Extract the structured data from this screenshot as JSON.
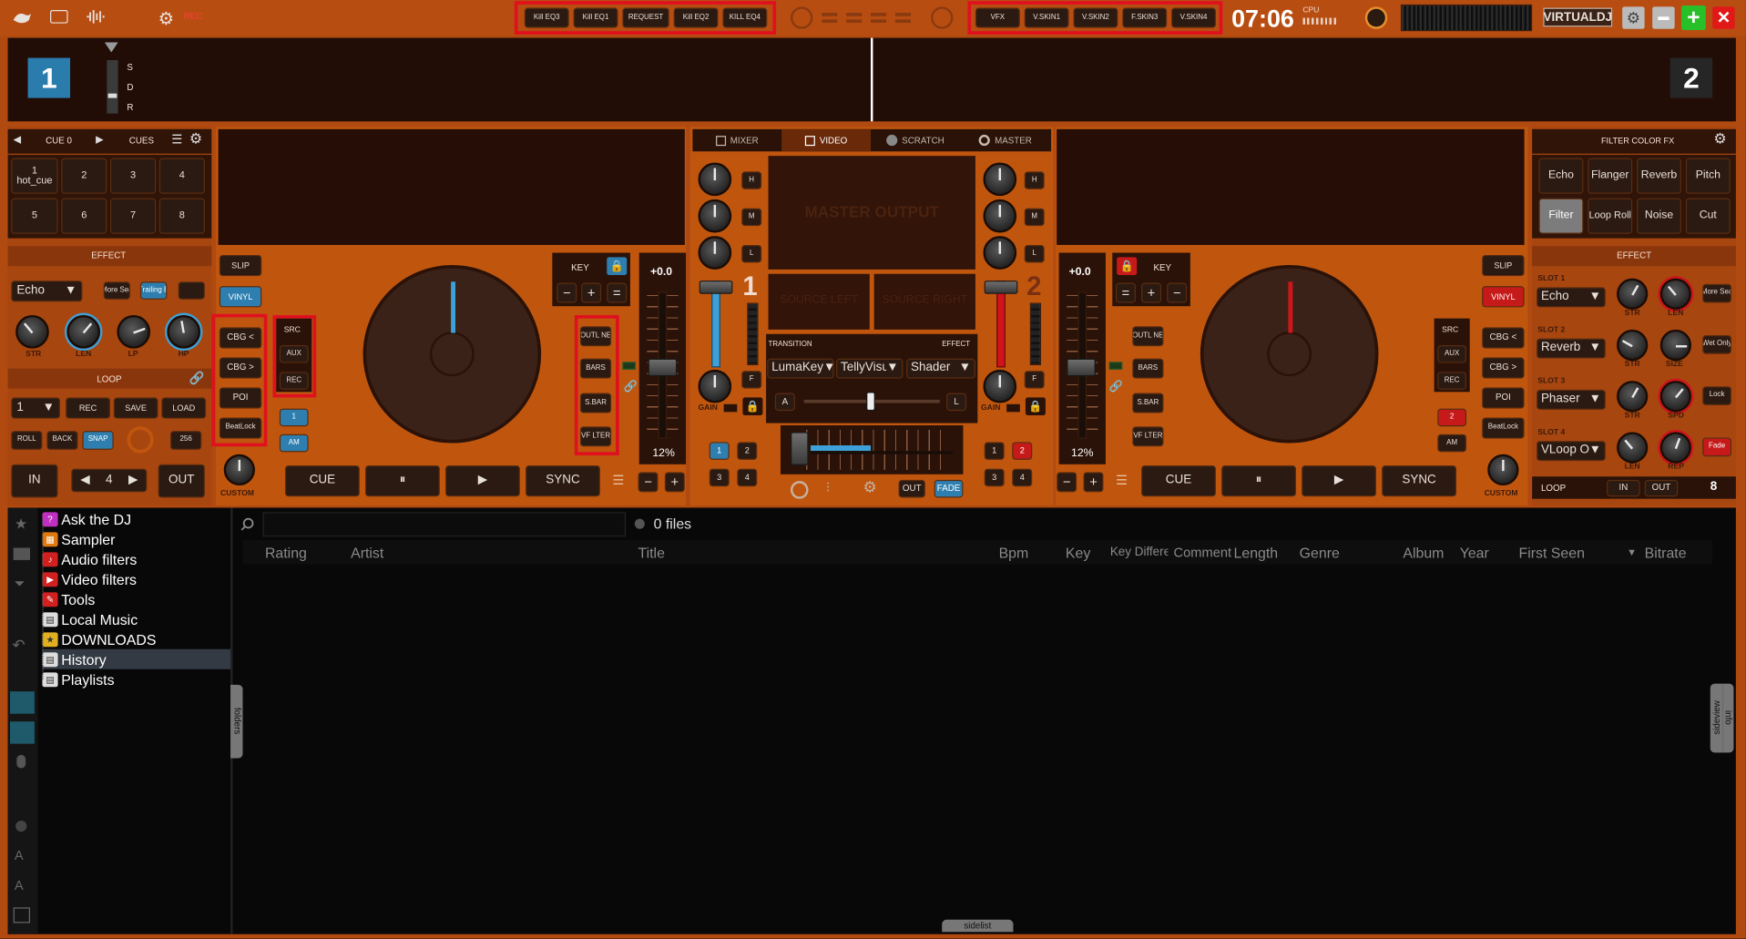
{
  "topbar": {
    "rec": "REC",
    "kill_buttons": [
      "Kill EQ3",
      "Kill EQ1",
      "REQUEST",
      "Kill EQ2",
      "KILL EQ4"
    ],
    "skin_buttons": [
      "VFX",
      "V.SKIN1",
      "V.SKIN2",
      "F.SKIN3",
      "V.SKIN4"
    ],
    "clock": "07:06",
    "cpu": "CPU",
    "logo": "VIRTUALDJ"
  },
  "waveform": {
    "deck1": "1",
    "deck2": "2",
    "sdr": [
      "S",
      "D",
      "R"
    ]
  },
  "left": {
    "cue_label": "CUE 0",
    "cues_label": "CUES",
    "pads": [
      "1\nhot_cue",
      "2",
      "3",
      "4",
      "5",
      "6",
      "7",
      "8"
    ],
    "effect_title": "EFFECT",
    "effect_select": "Echo",
    "fx_btn1": "More Sea",
    "fx_btn2": "Trailing E",
    "knobs": [
      "STR",
      "LEN",
      "LP",
      "HP"
    ],
    "loop_title": "LOOP",
    "loop_select": "1",
    "loop_btns": [
      "REC",
      "SAVE",
      "LOAD"
    ],
    "loop_row2": [
      "ROLL",
      "BACK",
      "SNAP"
    ],
    "loop_256": "256",
    "in": "IN",
    "out": "OUT",
    "loop_len": "4"
  },
  "deck1": {
    "slip": "SLIP",
    "vinyl": "VINYL",
    "cbg_prev": "CBG <",
    "cbg_next": "CBG >",
    "poi": "POI",
    "beatlock": "BeatLock",
    "custom": "CUSTOM",
    "src": "SRC",
    "aux": "AUX",
    "rec": "REC",
    "b1": "1",
    "am": "AM",
    "key": "KEY",
    "pitch_val": "+0.0",
    "pitch_pct": "12%",
    "outline": "OUTL NE",
    "bars": "BARS",
    "sbar": "S.BAR",
    "vfilter": "VF LTER",
    "cue": "CUE",
    "play": "▶",
    "sync": "SYNC"
  },
  "mixer": {
    "tabs": [
      "MIXER",
      "VIDEO",
      "SCRATCH",
      "MASTER"
    ],
    "eq": [
      "H",
      "M",
      "L"
    ],
    "f": "F",
    "gain": "GAIN",
    "ch1": "1",
    "ch2": "2",
    "master_output": "MASTER OUTPUT",
    "source_left": "SOURCE LEFT",
    "source_right": "SOURCE RIGHT",
    "transition": "TRANSITION",
    "effect": "EFFECT",
    "trans_select": "LumaKey",
    "fx_select": "TellyVisuals",
    "shader_select": "Shader",
    "a": "A",
    "l": "L",
    "out": "OUT",
    "fade": "FADE",
    "deck_btns_l": [
      "1",
      "2",
      "3",
      "4"
    ],
    "deck_btns_r": [
      "1",
      "2",
      "3",
      "4"
    ]
  },
  "deck2": {
    "slip": "SLIP",
    "vinyl": "VINYL",
    "cbg_prev": "CBG <",
    "cbg_next": "CBG >",
    "poi": "POI",
    "beatlock": "BeatLock",
    "custom": "CUSTOM",
    "src": "SRC",
    "aux": "AUX",
    "rec": "REC",
    "b2": "2",
    "am": "AM",
    "key": "KEY",
    "pitch_val": "+0.0",
    "pitch_pct": "12%",
    "outline": "OUTL NE",
    "bars": "BARS",
    "sbar": "S.BAR",
    "vfilter": "VF LTER",
    "cue": "CUE",
    "play": "▶",
    "sync": "SYNC"
  },
  "right": {
    "title": "FILTER COLOR FX",
    "fx": [
      "Echo",
      "Flanger",
      "Reverb",
      "Pitch",
      "Filter",
      "Loop Roll",
      "Noise",
      "Cut"
    ],
    "effect_title": "EFFECT",
    "slots": [
      {
        "label": "SLOT 1",
        "select": "Echo",
        "k1": "STR",
        "k2": "LEN",
        "btn": "More Sea"
      },
      {
        "label": "SLOT 2",
        "select": "Reverb",
        "k1": "STR",
        "k2": "SIZE",
        "btn": "Wet Only"
      },
      {
        "label": "SLOT 3",
        "select": "Phaser",
        "k1": "STR",
        "k2": "SPD",
        "btn": "Lock"
      },
      {
        "label": "SLOT 4",
        "select": "VLoop Out",
        "k1": "LEN",
        "k2": "REP",
        "btn": "Fade"
      }
    ],
    "loop": "LOOP",
    "in": "IN",
    "out": "OUT",
    "loop_len": "8"
  },
  "browser": {
    "tree": [
      "Ask the DJ",
      "Sampler",
      "Audio filters",
      "Video filters",
      "Tools",
      "Local Music",
      "DOWNLOADS",
      "History",
      "Playlists"
    ],
    "files": "0 files",
    "columns": [
      "Rating",
      "Artist",
      "Title",
      "Bpm",
      "Key",
      "Key Differen",
      "Comment",
      "Length",
      "Genre",
      "Album",
      "Year",
      "First Seen",
      "Bitrate"
    ],
    "folders": "folders",
    "sideview": "sideview",
    "info": "info",
    "sidelist": "sidelist"
  }
}
